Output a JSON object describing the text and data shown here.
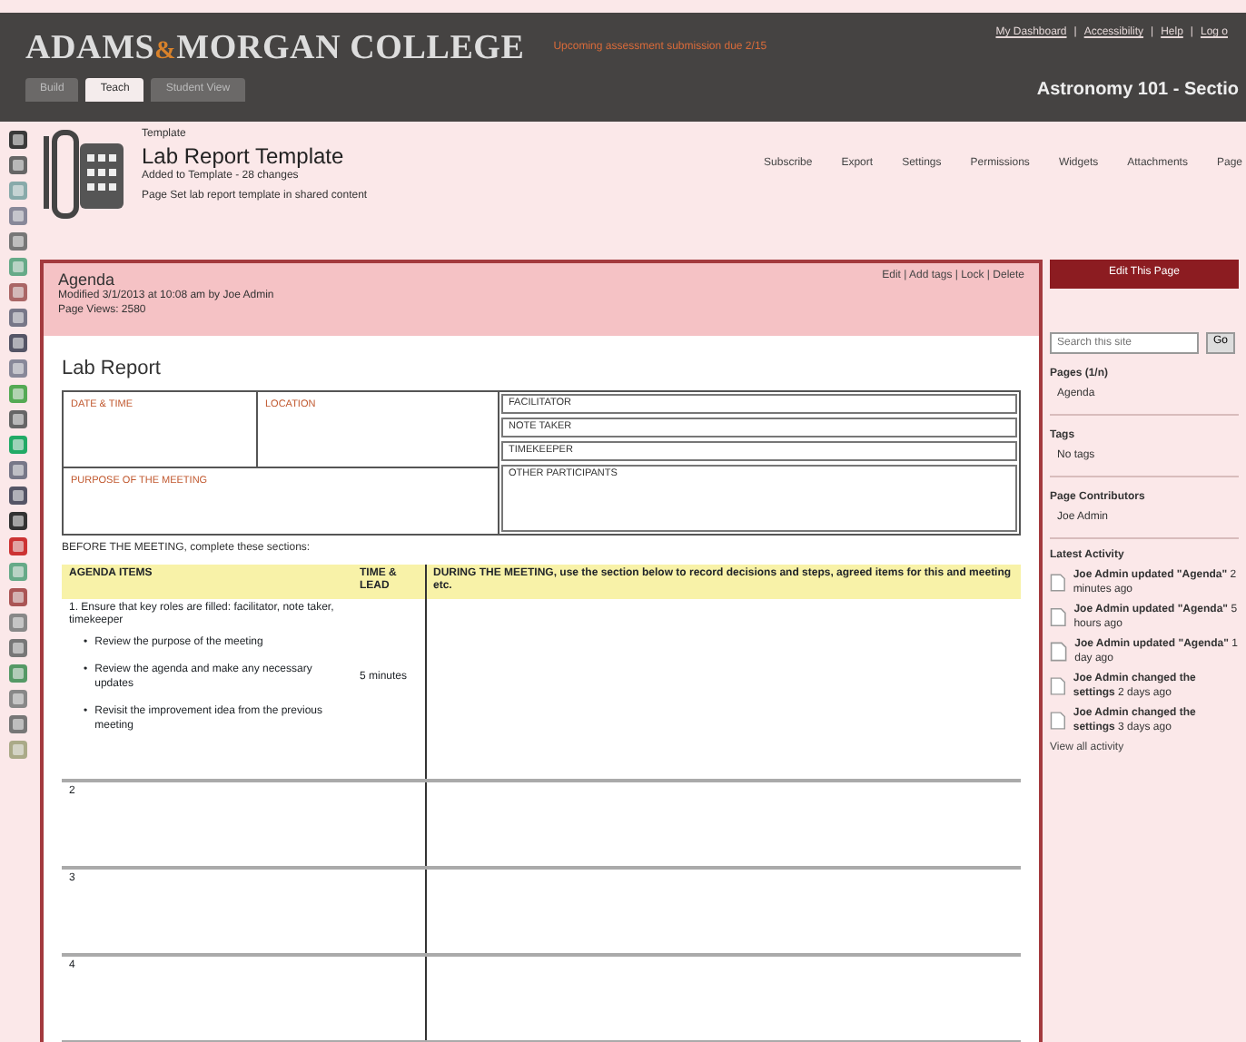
{
  "header": {
    "logo_left": "ADAMS",
    "logo_amp": "&",
    "logo_right": "MORGAN COLLEGE",
    "tagline": "Upcoming assessment submission due 2/15",
    "links": [
      "My Dashboard",
      "Accessibility",
      "Help",
      "Log o"
    ],
    "separator": "|",
    "tabs": [
      {
        "label": "Build",
        "selected": false
      },
      {
        "label": "Teach",
        "selected": true
      },
      {
        "label": "Student View",
        "selected": false
      }
    ],
    "course_title": "Astronomy 101 - Sectio"
  },
  "page_header": {
    "breadcrumb": "Template",
    "title": "Lab Report Template",
    "meta": "Added to Template - 28 changes",
    "note": "Page Set lab report template in shared content",
    "actions": [
      "Subscribe",
      "Export",
      "Settings",
      "Permissions",
      "Widgets",
      "Attachments",
      "Page"
    ]
  },
  "panel": {
    "title": "Agenda",
    "info": "Modified 3/1/2013 at 10:08 am by Joe Admin",
    "views": "Page Views: 2580",
    "actions": "Edit | Add tags | Lock | Delete",
    "doc_title": "Lab Report",
    "fields_left": [
      "DATE & TIME",
      "LOCATION",
      "PURPOSE OF THE MEETING"
    ],
    "fields_right": [
      "FACILITATOR",
      "NOTE TAKER",
      "TIMEKEEPER",
      "OTHER PARTICIPANTS"
    ],
    "before": "BEFORE THE MEETING, complete these sections:",
    "columns": [
      "AGENDA ITEMS",
      "TIME & LEAD",
      "DURING THE MEETING, use the section below to record decisions and steps, agreed items for this and meeting etc."
    ],
    "first_item": "1. Ensure that key roles are filled: facilitator, note taker, timekeeper",
    "bullets": [
      "Review the purpose of the meeting",
      "Review the agenda and make any necessary updates",
      "Revisit the improvement idea from the previous meeting"
    ],
    "first_time": "5 minutes",
    "bullet_marker": "•",
    "row_numbers": [
      "2",
      "3",
      "4"
    ]
  },
  "sidebar": {
    "button": "Edit This Page",
    "search_placeholder": "Search this site",
    "search_button": "Go",
    "sections": [
      {
        "title": "Pages (1/n)",
        "items": [
          "Agenda"
        ]
      },
      {
        "title": "Tags",
        "items": [
          "No tags"
        ]
      },
      {
        "title": "Page Contributors",
        "items": [
          "Joe Admin"
        ]
      }
    ],
    "activity_title": "Latest Activity",
    "activity": [
      {
        "text": "Joe Admin updated \"Agenda\"",
        "time": "2 minutes ago"
      },
      {
        "text": "Joe Admin updated \"Agenda\"",
        "time": "5 hours ago"
      },
      {
        "text": "Joe Admin updated \"Agenda\"",
        "time": "1 day ago"
      },
      {
        "text": "Joe Admin changed the settings",
        "time": "2 days ago"
      },
      {
        "text": "Joe Admin changed the settings",
        "time": "3 days ago"
      }
    ],
    "view_all": "View all activity"
  }
}
